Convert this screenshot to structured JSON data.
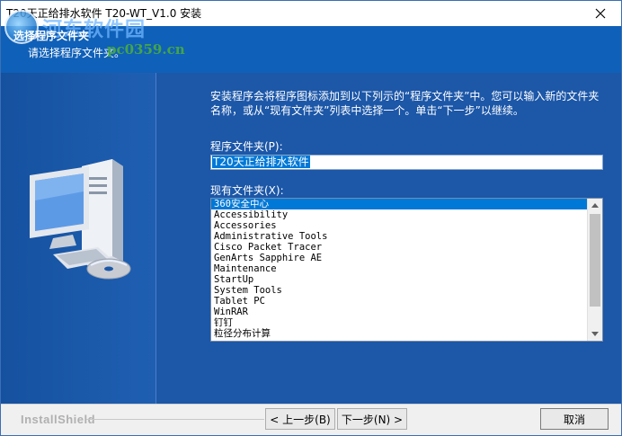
{
  "window": {
    "title": "T20天正给排水软件 T20-WT_V1.0 安装"
  },
  "header": {
    "title": "选择程序文件夹",
    "subtitle": "请选择程序文件夹。",
    "watermark_text": "河东软件园",
    "watermark_url": "pc0359.cn"
  },
  "content": {
    "description": "安装程序会将程序图标添加到以下列示的“程序文件夹”中。您可以输入新的文件夹名称，或从“现有文件夹”列表中选择一个。单击“下一步”以继续。",
    "program_folder_label": "程序文件夹(P):",
    "program_folder_value": "T20天正给排水软件",
    "existing_folders_label": "现有文件夹(X):",
    "existing_folders": [
      "360安全中心",
      "Accessibility",
      "Accessories",
      "Administrative Tools",
      "Cisco Packet Tracer",
      "GenArts Sapphire AE",
      "Maintenance",
      "StartUp",
      "System Tools",
      "Tablet PC",
      "WinRAR",
      "钉钉",
      "粒径分布计算"
    ],
    "selected_index": 0
  },
  "footer": {
    "brand": "InstallShield",
    "back_label": "< 上一步(B)",
    "next_label": "下一步(N) >",
    "cancel_label": "取消"
  },
  "colors": {
    "header_bg": "#0f60b8",
    "main_bg": "#1c57a8",
    "selection": "#0078d7"
  }
}
